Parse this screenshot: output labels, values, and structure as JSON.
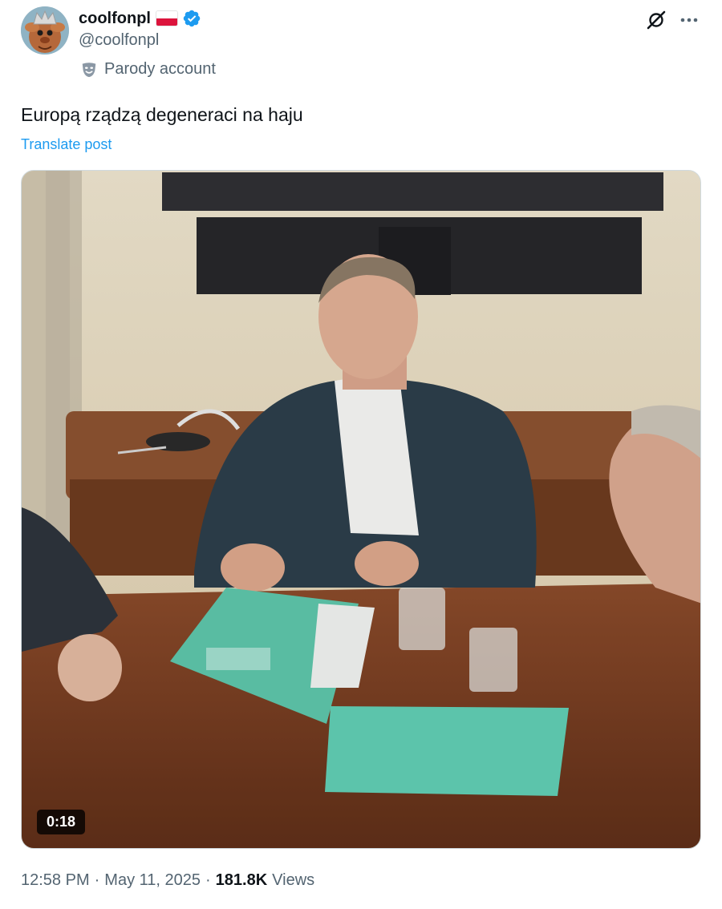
{
  "author": {
    "display_name": "coolfonpl",
    "handle": "@coolfonpl",
    "badge_icon": "verified-badge-icon",
    "flag": "flag-poland-icon",
    "label_text": "Parody account",
    "label_icon": "theater-mask-icon"
  },
  "post": {
    "text": "Europą rządzą degeneraci na haju",
    "translate_label": "Translate post"
  },
  "media": {
    "type": "video",
    "duration": "0:18"
  },
  "meta": {
    "time": "12:58 PM",
    "date": "May 11, 2025",
    "separator": "·",
    "views_count": "181.8K",
    "views_label": "Views"
  },
  "header_actions": {
    "grok_icon": "grok-icon",
    "more_icon": "more-icon"
  },
  "colors": {
    "text_primary": "#0f1419",
    "text_secondary": "#536471",
    "link": "#1d9bf0",
    "verified": "#1d9bf0",
    "border": "#cfd9de"
  }
}
